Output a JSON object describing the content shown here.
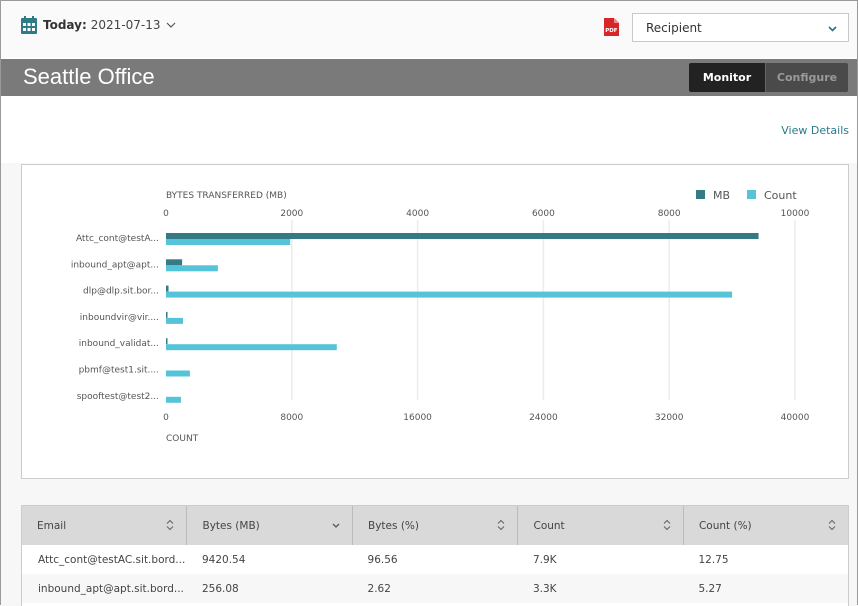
{
  "header": {
    "date_label": "Today:",
    "date_value": "2021-07-13",
    "icons": {
      "calendar": "calendar-icon",
      "date_chevron": "chevron-down-icon",
      "pdf": "pdf-icon"
    },
    "report_select": {
      "value": "Recipient"
    }
  },
  "titlebar": {
    "title": "Seattle Office",
    "tabs": [
      {
        "label": "Monitor",
        "active": true
      },
      {
        "label": "Configure",
        "active": false
      }
    ]
  },
  "view_details_label": "View Details",
  "colors": {
    "mb": "#357a85",
    "count": "#55c4d8",
    "title_bg": "#7a7a7a"
  },
  "chart_data": {
    "type": "bar",
    "orientation": "horizontal",
    "categories": [
      "Attc_cont@testA...",
      "inbound_apt@apt...",
      "dlp@dlp.sit.bor...",
      "inboundvir@vir....",
      "inbound_validat...",
      "pbmf@test1.sit....",
      "spooftest@test2..."
    ],
    "series": [
      {
        "name": "MB",
        "axis": "top",
        "values": [
          9420.54,
          256.08,
          40,
          20,
          8,
          0,
          0
        ]
      },
      {
        "name": "Count",
        "axis": "bottom",
        "values": [
          7900,
          3300,
          36000,
          1080,
          10860,
          1520,
          950
        ]
      }
    ],
    "top_axis": {
      "label": "BYTES TRANSFERRED (MB)",
      "range": [
        0,
        10000
      ],
      "ticks": [
        "0",
        "2000",
        "4000",
        "6000",
        "8000",
        "10000"
      ]
    },
    "bottom_axis": {
      "label": "COUNT",
      "range": [
        0,
        40000
      ],
      "ticks": [
        "0",
        "8000",
        "16000",
        "24000",
        "32000",
        "40000"
      ]
    },
    "legend": [
      "MB",
      "Count"
    ],
    "legend_position": "top-right",
    "grid": true
  },
  "table": {
    "columns": [
      {
        "label": "Email",
        "sort": "sortable"
      },
      {
        "label": "Bytes (MB)",
        "sort": "descending"
      },
      {
        "label": "Bytes (%)",
        "sort": "sortable"
      },
      {
        "label": "Count",
        "sort": "sortable"
      },
      {
        "label": "Count (%)",
        "sort": "sortable"
      }
    ],
    "rows": [
      [
        "Attc_cont@testAC.sit.bord...",
        "9420.54",
        "96.56",
        "7.9K",
        "12.75"
      ],
      [
        "inbound_apt@apt.sit.bord...",
        "256.08",
        "2.62",
        "3.3K",
        "5.27"
      ]
    ]
  }
}
